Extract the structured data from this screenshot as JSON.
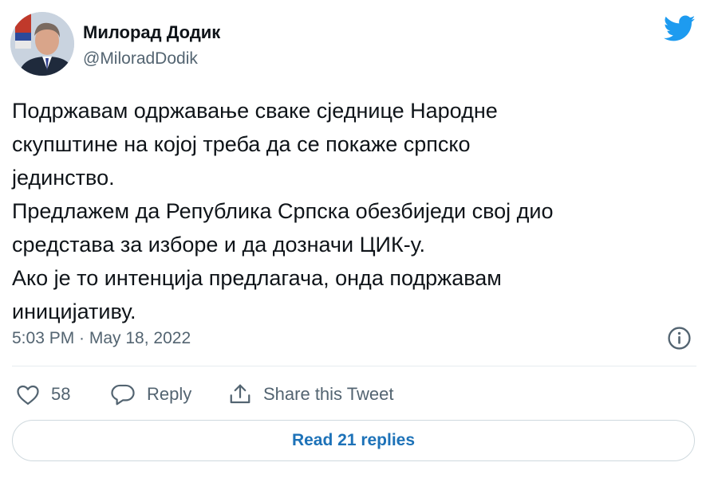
{
  "author": {
    "name": "Милорад Додик",
    "handle": "@MiloradDodik"
  },
  "icons": {
    "brand": "twitter-bird-icon",
    "info": "info-icon",
    "like": "heart-icon",
    "reply": "speech-bubble-icon",
    "share": "share-icon"
  },
  "tweet": {
    "lines": [
      "Подржавам одржавање сваке сједнице Народне",
      "скупштине на којој треба да се покаже српско",
      "јединство.",
      "Предлажем да Република Српска обезбиједи свој дио",
      "средстава за изборе и да дозначи ЦИК-у.",
      "Ако је то интенција предлагача, онда подржавам",
      "иницијативу."
    ],
    "timestamp": "5:03 PM · May 18, 2022"
  },
  "actions": {
    "likes": "58",
    "reply_label": "Reply",
    "share_label": "Share this Tweet"
  },
  "read_replies_label": "Read 21 replies",
  "colors": {
    "brand_blue": "#1d9bf0",
    "link_blue": "#1d72b8",
    "text_primary": "#0f1419",
    "text_secondary": "#536471",
    "border": "#cfd9de"
  }
}
